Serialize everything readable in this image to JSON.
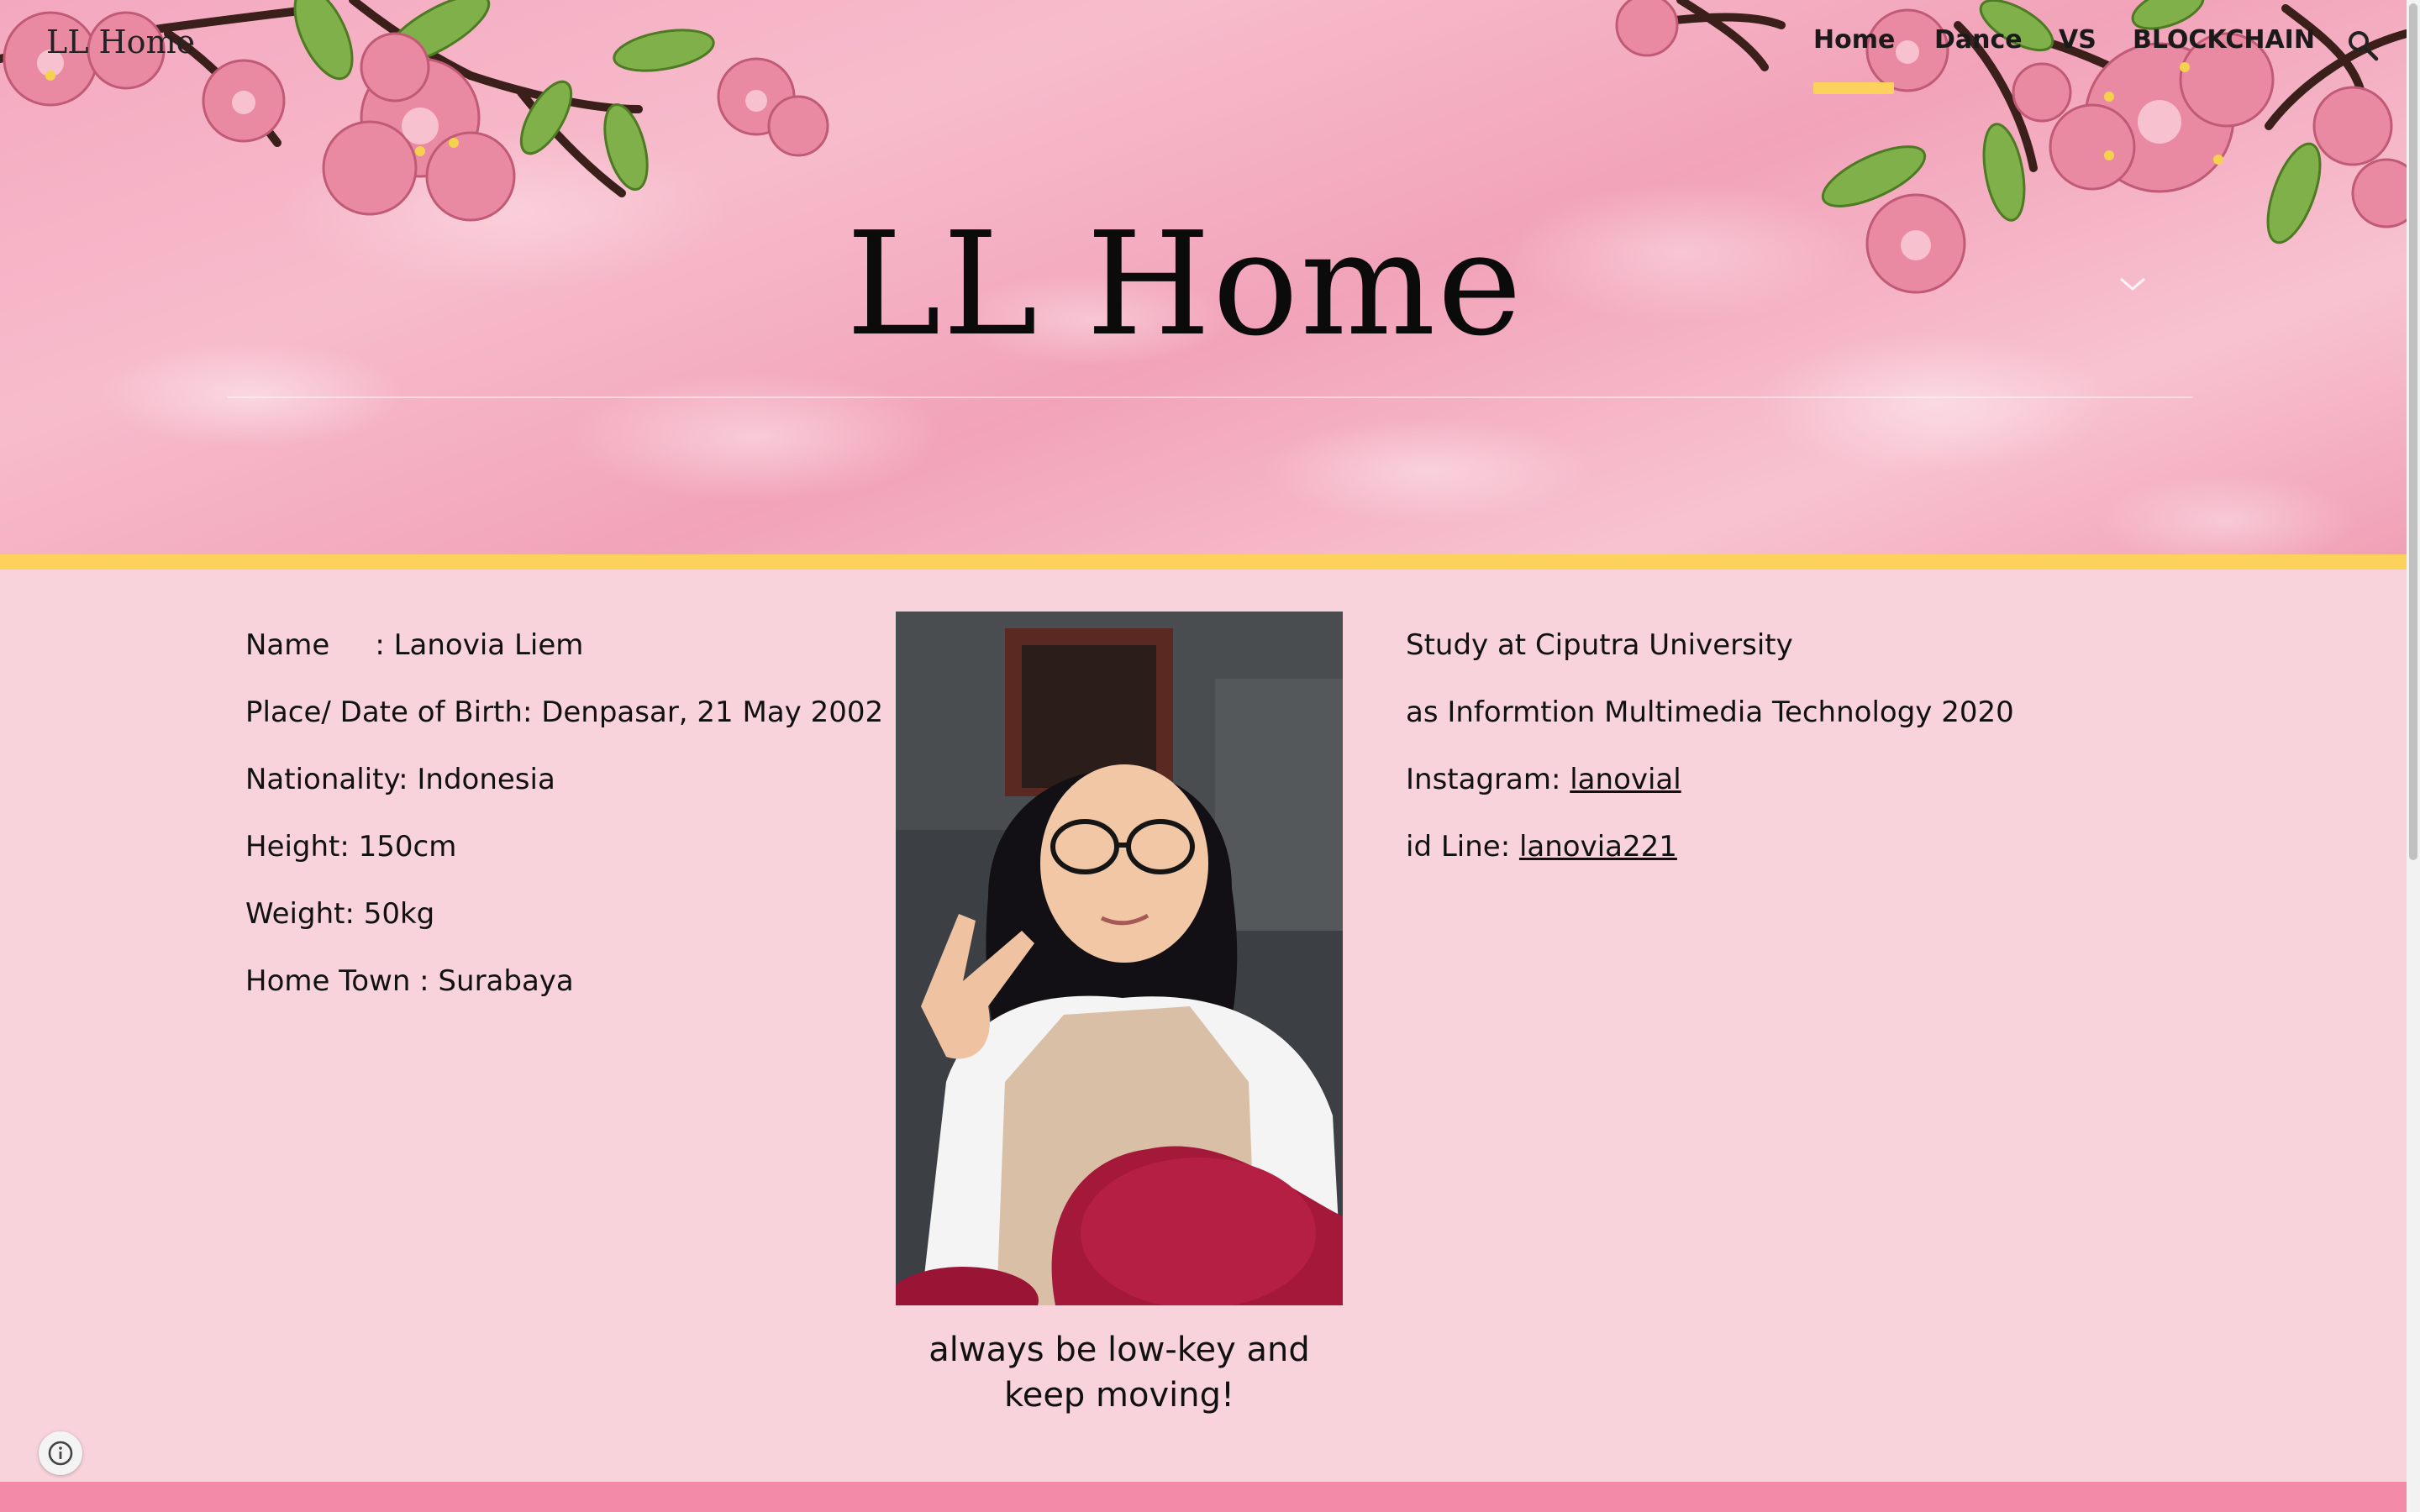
{
  "site": {
    "title": "LL Home",
    "hero_title": "LL Home"
  },
  "nav": {
    "items": [
      {
        "label": "Home",
        "active": true
      },
      {
        "label": "Dance",
        "active": false
      },
      {
        "label": "VS",
        "active": false
      },
      {
        "label": "BLOCKCHAIN",
        "active": false
      }
    ],
    "search_icon": "search-icon"
  },
  "profile": {
    "left": [
      "Name     : Lanovia Liem",
      "Place/ Date of Birth: Denpasar, 21 May 2002",
      "Nationality: Indonesia",
      "Height: 150cm",
      "Weight: 50kg",
      "Home Town : Surabaya"
    ],
    "right": {
      "study": "Study at Ciputra University",
      "program": "as Informtion Multimedia Technology 2020",
      "instagram_label": "Instagram: ",
      "instagram_link": "lanovial",
      "line_label": "id Line: ",
      "line_link": "lanovia221"
    },
    "caption_line1": "always be low-key and",
    "caption_line2": "keep moving!"
  },
  "colors": {
    "background": "#f8d3dc",
    "accent_yellow": "#fcd25d",
    "footer_pink": "#f28aa8"
  },
  "icons": {
    "info": "info-icon",
    "chevron": "chevron-down-icon"
  }
}
